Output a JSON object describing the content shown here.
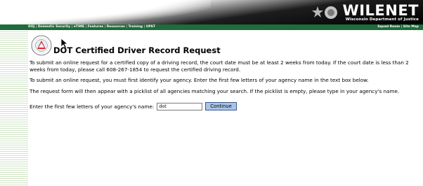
{
  "header": {
    "logo_title": "WILENET",
    "logo_subtitle": "Wisconsin Department of Justice"
  },
  "nav": {
    "items": [
      "DOJ",
      "Domestic Security",
      "eTIME",
      "Features",
      "Resources",
      "Training",
      "UPST"
    ],
    "separator": "|",
    "right_items": [
      "Squad Room",
      "Site Map"
    ]
  },
  "page": {
    "title": "DOT Certified Driver Record Request",
    "paragraphs": [
      "To submit an online request for a certified copy of a driving record, the court date must be at least 2 weeks from today. If the court date is less than 2 weeks from today, please call 608-267-1854 to request the certified driving record.",
      "To submit an online request, you must first identify your agency. Enter the first few letters of your agency name in the text box below.",
      "The request form will then appear with a picklist of all agencies matching your search. If the picklist is empty, please type in your agency's name."
    ]
  },
  "form": {
    "label": "Enter the first few letters of your agency's name:",
    "agency_value": "dot",
    "continue_label": "Continue"
  },
  "colors": {
    "nav_green": "#1f6b3a",
    "button_blue": "#a9c4e6"
  }
}
